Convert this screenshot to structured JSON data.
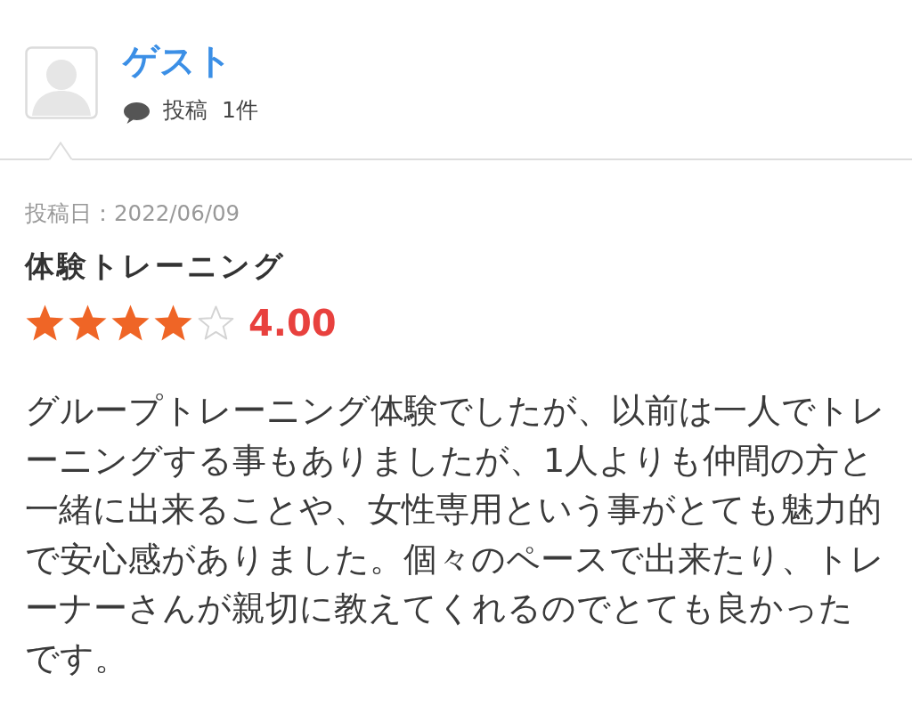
{
  "author": {
    "name": "ゲスト",
    "post_label": "投稿",
    "post_count": "1件"
  },
  "review": {
    "date": "投稿日：2022/06/09",
    "title": "体験トレーニング",
    "stars": 4,
    "rating": "4.00",
    "body": "グループトレーニング体験でしたが、以前は一人でトレーニングする事もありましたが、1人よりも仲間の方と一緒に出来ることや、女性専用という事がとても魅力的で安心感がありました。個々のペースで出来たり、トレーナーさんが親切に教えてくれるのでとても良かったです。"
  }
}
